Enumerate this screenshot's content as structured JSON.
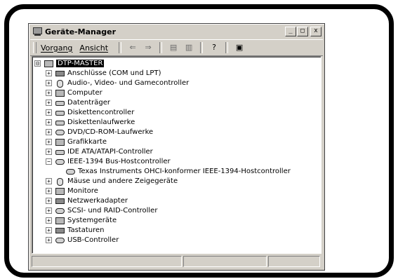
{
  "window": {
    "title": "Geräte-Manager",
    "buttons": {
      "minimize": "_",
      "maximize": "□",
      "close": "x"
    }
  },
  "menu": [
    {
      "label": "Vorgang"
    },
    {
      "label": "Ansicht"
    }
  ],
  "toolbar": {
    "icons": [
      "back-icon",
      "forward-icon",
      "properties-icon",
      "view-icon",
      "help-icon",
      "scan-icon"
    ],
    "glyphs": {
      "back": "⇐",
      "forward": "⇒",
      "properties": "▤",
      "view": "▥",
      "help": "?",
      "scan": "▣"
    }
  },
  "tree": {
    "root": {
      "label": "DTP-MASTER",
      "expander": "⊟"
    },
    "items": [
      {
        "label": "Anschlüsse (COM und LPT)",
        "expander": "+"
      },
      {
        "label": "Audio-, Video- und Gamecontroller",
        "expander": "+"
      },
      {
        "label": "Computer",
        "expander": "+"
      },
      {
        "label": "Datenträger",
        "expander": "+"
      },
      {
        "label": "Diskettencontroller",
        "expander": "+"
      },
      {
        "label": "Diskettenlaufwerke",
        "expander": "+"
      },
      {
        "label": "DVD/CD-ROM-Laufwerke",
        "expander": "+"
      },
      {
        "label": "Grafikkarte",
        "expander": "+"
      },
      {
        "label": "IDE ATA/ATAPI-Controller",
        "expander": "+"
      },
      {
        "label": "IEEE-1394 Bus-Hostcontroller",
        "expander": "−"
      },
      {
        "label": "Texas Instruments OHCI-konformer IEEE-1394-Hostcontroller"
      },
      {
        "label": "Mäuse und andere Zeigegeräte",
        "expander": "+"
      },
      {
        "label": "Monitore",
        "expander": "+"
      },
      {
        "label": "Netzwerkadapter",
        "expander": "+"
      },
      {
        "label": "SCSI- und RAID-Controller",
        "expander": "+"
      },
      {
        "label": "Systemgeräte",
        "expander": "+"
      },
      {
        "label": "Tastaturen",
        "expander": "+"
      },
      {
        "label": "USB-Controller",
        "expander": "+"
      }
    ]
  }
}
